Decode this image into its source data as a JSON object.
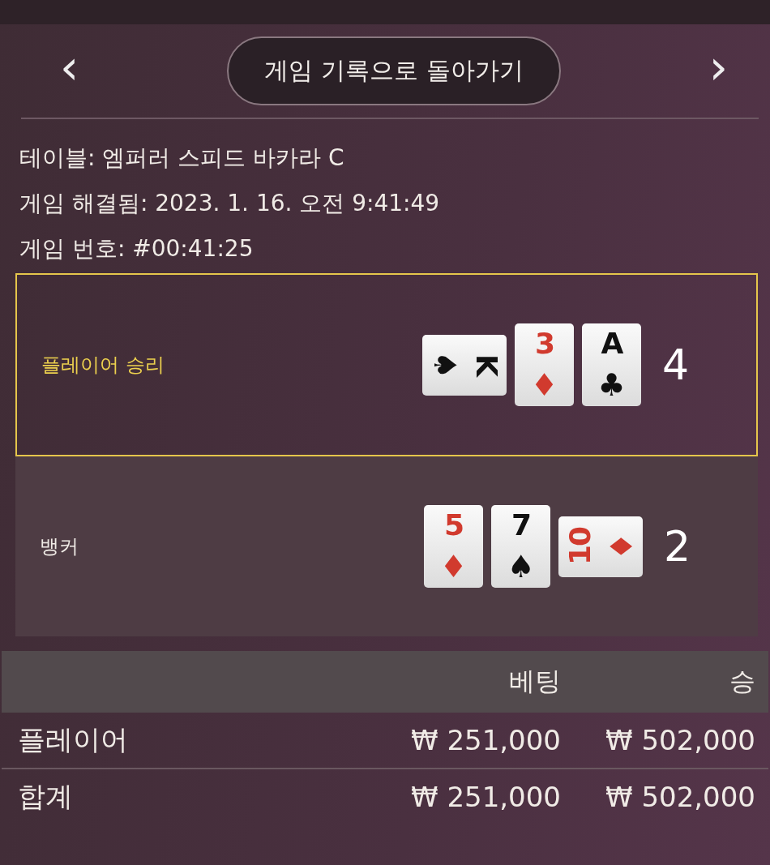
{
  "nav": {
    "back_button": "게임 기록으로 돌아가기",
    "prev": "‹",
    "next": "›"
  },
  "info": [
    "테이블: 엠퍼러 스피드 바카라 C",
    "게임 해결됨: 2023. 1. 16. 오전 9:41:49",
    "게임 번호: #00:41:25"
  ],
  "hands": [
    {
      "label": "플레이어 승리",
      "winner": true,
      "score": "4",
      "cards": [
        {
          "rank": "K",
          "suit": "♠",
          "color": "#111111",
          "kind": "turned-right"
        },
        {
          "rank": "3",
          "suit": "♦",
          "color": "#d13a2e",
          "kind": "upright"
        },
        {
          "rank": "A",
          "suit": "♣",
          "color": "#111111",
          "kind": "upright"
        }
      ]
    },
    {
      "label": "뱅커",
      "winner": false,
      "score": "2",
      "cards": [
        {
          "rank": "5",
          "suit": "♦",
          "color": "#d13a2e",
          "kind": "upright"
        },
        {
          "rank": "7",
          "suit": "♠",
          "color": "#111111",
          "kind": "upright"
        },
        {
          "rank": "10",
          "suit": "♦",
          "color": "#d13a2e",
          "kind": "turned-left"
        }
      ]
    }
  ],
  "bets": {
    "columns": [
      "베팅",
      "승"
    ],
    "rows": [
      {
        "name": "플레이어",
        "bet": "₩ 251,000",
        "win": "₩ 502,000"
      },
      {
        "name": "합계",
        "bet": "₩ 251,000",
        "win": "₩ 502,000"
      }
    ]
  }
}
